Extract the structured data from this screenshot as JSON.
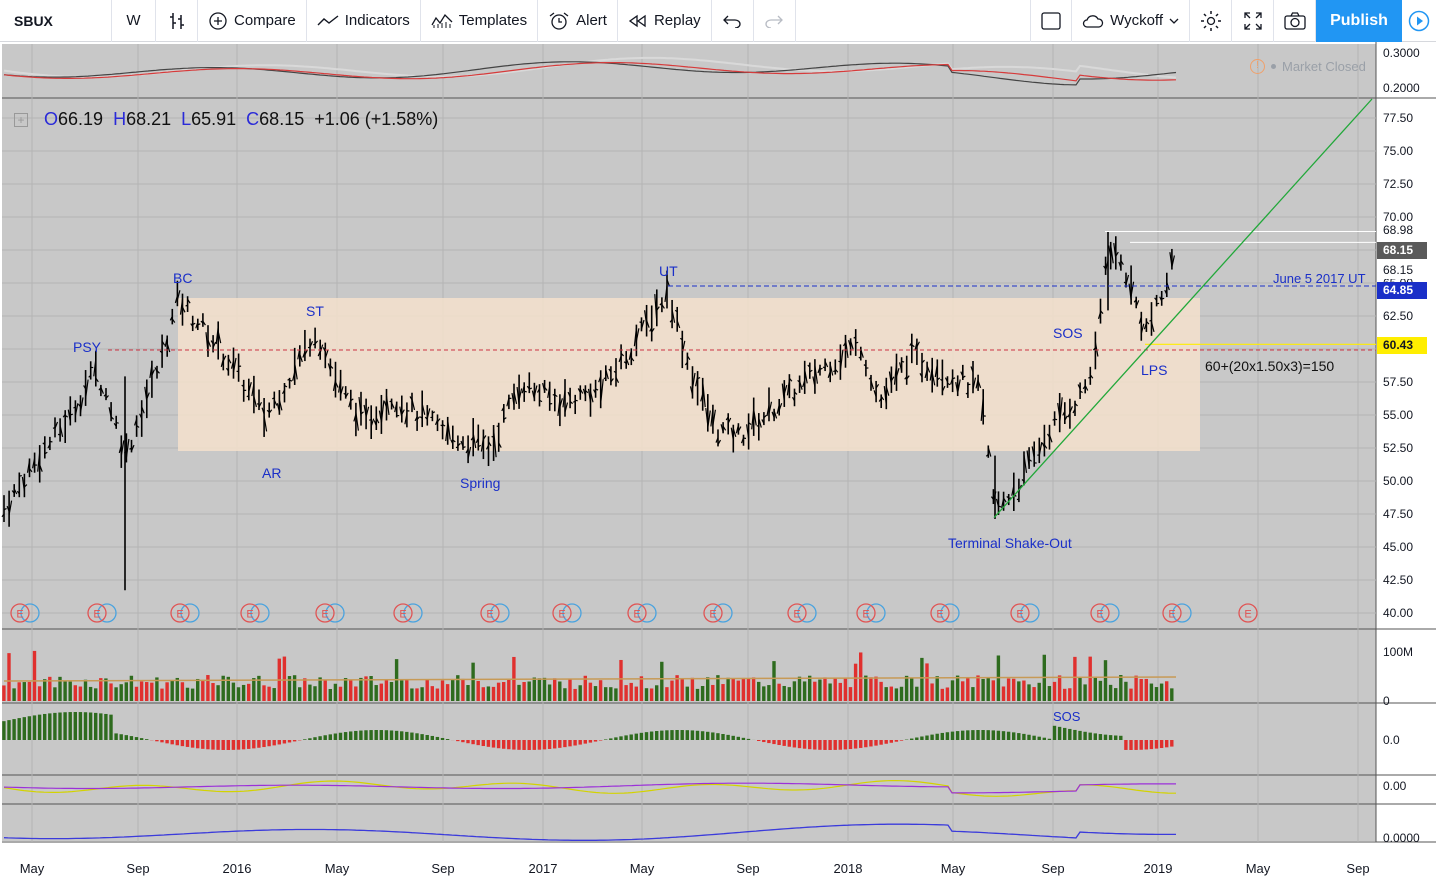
{
  "toolbar": {
    "symbol": "SBUX",
    "interval": "W",
    "compare": "Compare",
    "indicators": "Indicators",
    "templates": "Templates",
    "alert": "Alert",
    "replay": "Replay",
    "layout_name": "Wyckoff",
    "publish": "Publish"
  },
  "legend": {
    "o_key": "O",
    "o": "66.19",
    "h_key": "H",
    "h": "68.21",
    "l_key": "L",
    "l": "65.91",
    "c_key": "C",
    "c": "68.15",
    "change": "+1.06 (+1.58%)"
  },
  "status": {
    "market": "Market Closed"
  },
  "annotations": {
    "psy": "PSY",
    "bc": "BC",
    "ar": "AR",
    "st": "ST",
    "spring": "Spring",
    "ut": "UT",
    "sos": "SOS",
    "lps": "LPS",
    "shakeout": "Terminal Shake-Out",
    "june_ut": "June 5 2017 UT",
    "formula": "60+(20x1.50x3)=150",
    "sos_pane": "SOS"
  },
  "price_axis": [
    "77.50",
    "75.00",
    "72.50",
    "70.00",
    "67.50",
    "65.00",
    "62.50",
    "60.00",
    "57.50",
    "55.00",
    "52.50",
    "50.00",
    "47.50",
    "45.00",
    "42.50",
    "40.00"
  ],
  "price_tags": {
    "high": "68.98",
    "last": "68.15",
    "prev": "68.15",
    "ut_level": "64.85",
    "lps_level": "60.43"
  },
  "top_pane_axis": [
    "0.3000",
    "0.2000"
  ],
  "volume_axis": [
    "100M",
    "0"
  ],
  "pane3_axis": "0.0",
  "pane4_axis": "0.00",
  "pane5_axis": "0.0000",
  "time_axis": [
    "May",
    "Sep",
    "2016",
    "May",
    "Sep",
    "2017",
    "May",
    "Sep",
    "2018",
    "May",
    "Sep",
    "2019",
    "May",
    "Sep"
  ],
  "earnings_marker": "E",
  "colors": {
    "background": "#c8c8c8",
    "range_box": "#f5e1cc",
    "up_volume": "#2e6b1e",
    "down_volume": "#e0302e",
    "trend_line": "#22a83a",
    "ut_line": "#1a2fc8",
    "resistance_line": "#cc3344",
    "accent": "#2196f3",
    "lps_tag": "#ffee00",
    "ut_tag": "#1a2fc8"
  }
}
